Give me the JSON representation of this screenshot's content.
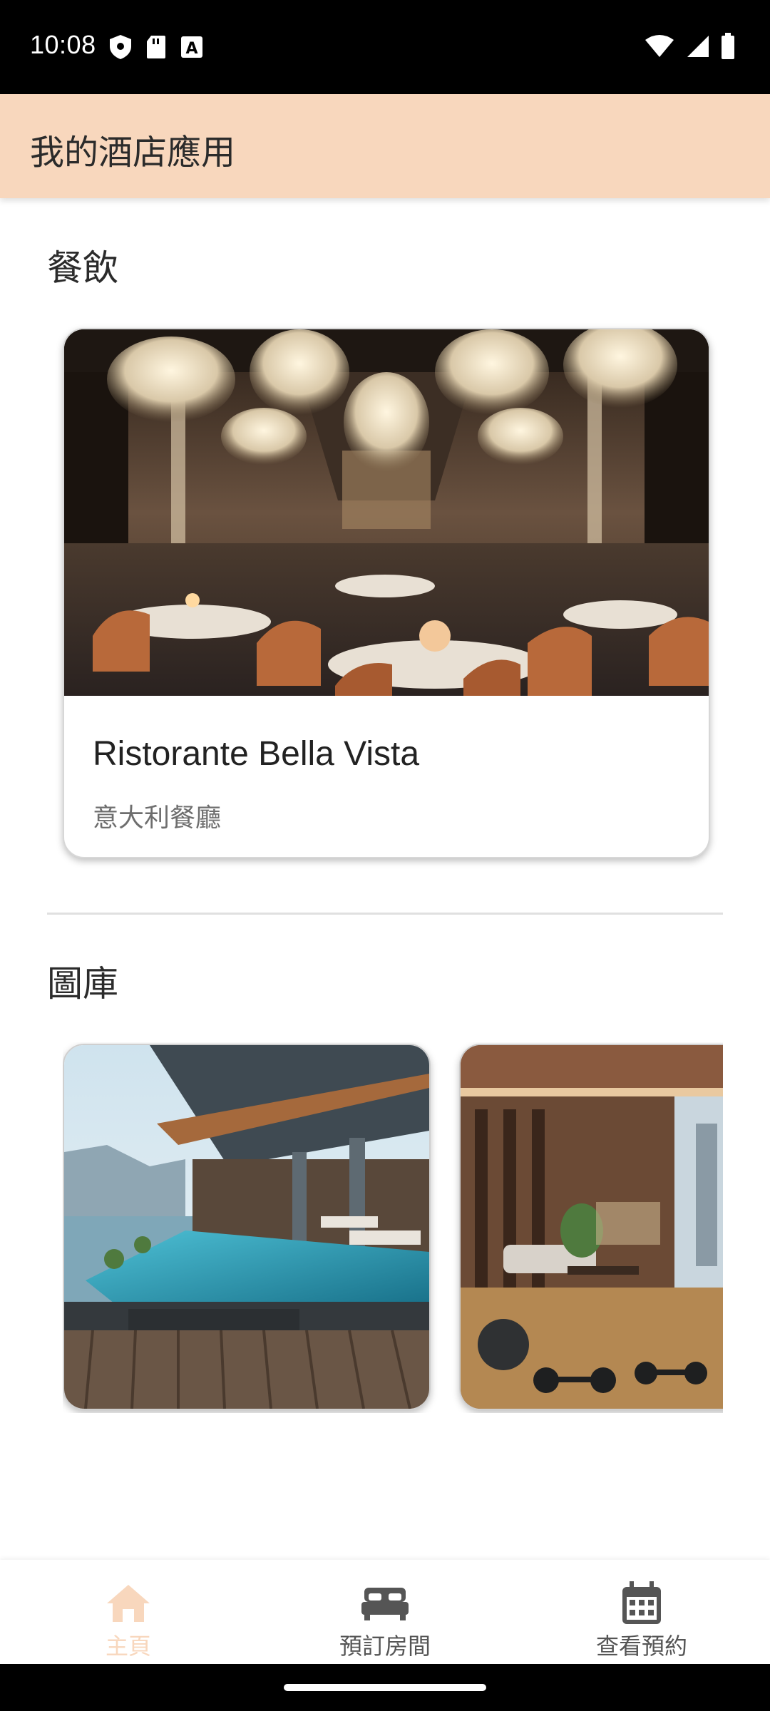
{
  "status_bar": {
    "time": "10:08",
    "left_icons": [
      "shield-icon",
      "sd-card-icon",
      "font-a-icon"
    ],
    "right_icons": [
      "wifi-icon",
      "signal-icon",
      "battery-icon"
    ]
  },
  "app_bar": {
    "title": "我的酒店應用"
  },
  "dining": {
    "section_title": "餐飲",
    "card": {
      "image_subject": "luxury restaurant dining hall with crystal chandeliers",
      "title": "Ristorante Bella Vista",
      "subtitle": "意大利餐廳"
    }
  },
  "gallery": {
    "section_title": "圖庫",
    "items": [
      {
        "subject": "infinity pool overlooking harbor"
      },
      {
        "subject": "hotel gym and lounge with city view"
      }
    ]
  },
  "bottom_nav": {
    "items": [
      {
        "label": "主頁",
        "icon": "home-icon",
        "active": true
      },
      {
        "label": "預訂房間",
        "icon": "bed-icon",
        "active": false
      },
      {
        "label": "查看預約",
        "icon": "calendar-icon",
        "active": false
      }
    ],
    "active_color": "#f8d7bd",
    "inactive_color": "#555555"
  },
  "colors": {
    "app_bar": "#f8d7bd",
    "status_bar": "#000000"
  }
}
